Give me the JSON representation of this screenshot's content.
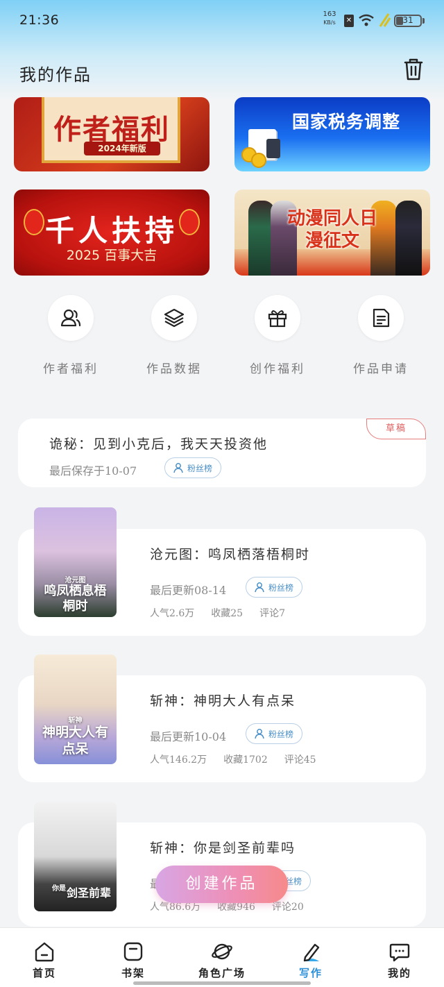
{
  "status_bar": {
    "time": "21:36",
    "net_speed": "163",
    "net_unit": "KB/s",
    "battery": "31"
  },
  "header": {
    "title": "我的作品"
  },
  "banners": [
    {
      "title": "作者福利",
      "subtitle": "2024年新版"
    },
    {
      "title": "国家税务调整"
    },
    {
      "title": "千人扶持",
      "subtitle": "2025 百事大吉"
    },
    {
      "title": "动漫同人日漫征文"
    }
  ],
  "quick_actions": [
    {
      "label": "作者福利",
      "icon": "users-icon"
    },
    {
      "label": "作品数据",
      "icon": "layers-icon"
    },
    {
      "label": "创作福利",
      "icon": "gift-icon"
    },
    {
      "label": "作品申请",
      "icon": "document-icon"
    }
  ],
  "works": [
    {
      "title": "诡秘：见到小克后，我天天投资他",
      "meta": "最后保存于10-07",
      "badge": "草稿",
      "fans_label": "粉丝榜"
    },
    {
      "title": "沧元图：鸣凤栖落梧桐时",
      "meta": "最后更新08-14",
      "fans_label": "粉丝榜",
      "stats": {
        "popularity": "人气2.6万",
        "favorites": "收藏25",
        "comments": "评论7"
      },
      "cover_text": "鸣凤栖息梧桐时",
      "cover_small": "沧元图"
    },
    {
      "title": "斩神：神明大人有点呆",
      "meta": "最后更新10-04",
      "fans_label": "粉丝榜",
      "stats": {
        "popularity": "人气146.2万",
        "favorites": "收藏1702",
        "comments": "评论45"
      },
      "cover_text": "神明大人有点呆",
      "cover_small": "斩神"
    },
    {
      "title": "斩神：你是剑圣前辈吗",
      "meta": "最",
      "fans_label": "粉丝榜",
      "stats": {
        "popularity": "人气86.6万",
        "favorites": "收藏946",
        "comments": "评论20"
      },
      "cover_text": "剑圣前辈",
      "cover_small": "你是"
    }
  ],
  "fab": {
    "label": "创建作品"
  },
  "bottom_nav": [
    {
      "label": "首页",
      "icon": "home-icon"
    },
    {
      "label": "书架",
      "icon": "bookshelf-icon"
    },
    {
      "label": "角色广场",
      "icon": "planet-icon"
    },
    {
      "label": "写作",
      "icon": "pen-icon",
      "active": true
    },
    {
      "label": "我的",
      "icon": "chat-icon"
    }
  ],
  "colors": {
    "accent": "#2a8fd8",
    "fab_start": "#d8a6e4",
    "fab_end": "#f68a8a",
    "draft": "#e06060"
  }
}
